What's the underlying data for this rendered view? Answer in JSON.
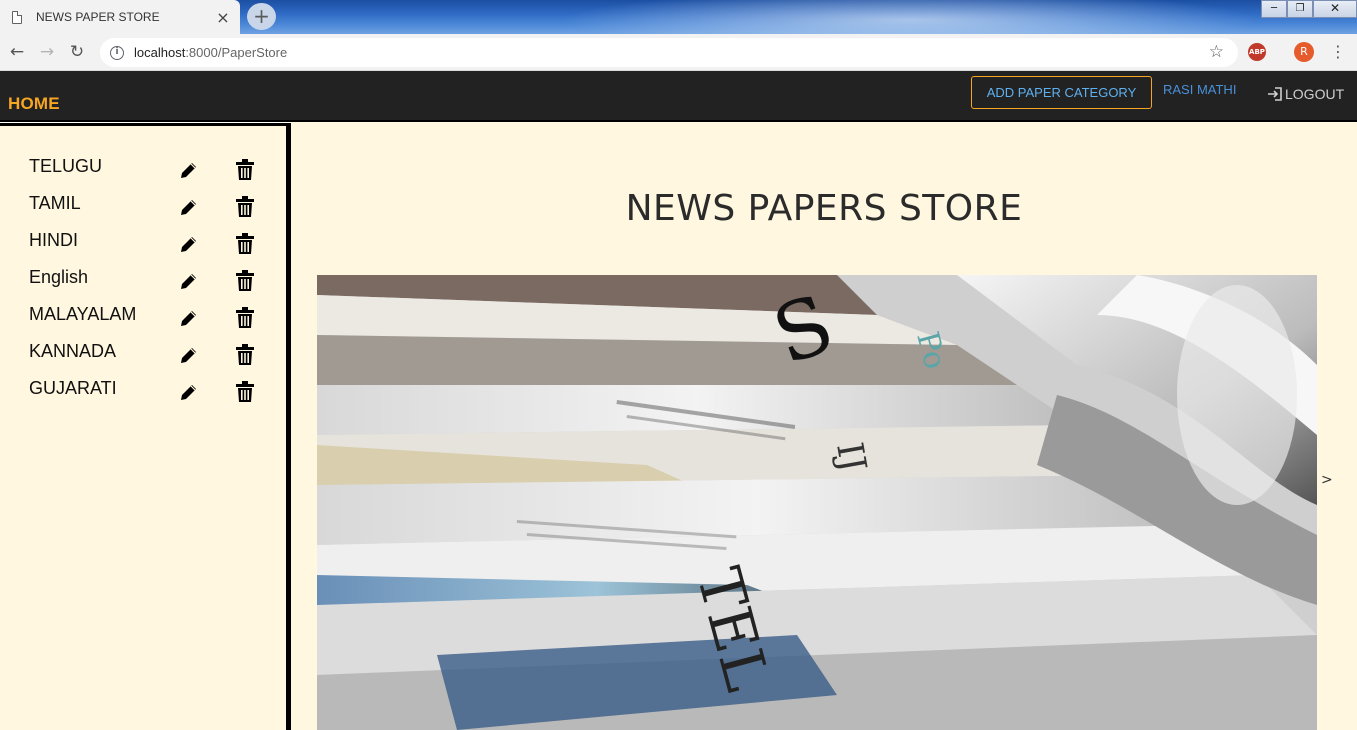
{
  "browser": {
    "tab_title": "NEWS PAPER STORE",
    "tab_close": "×",
    "new_tab": "+",
    "url_host": "localhost",
    "url_path": ":8000/PaperStore",
    "abp": "ABP",
    "profile_initial": "R"
  },
  "navbar": {
    "brand": "HOME",
    "add_category": "ADD PAPER CATEGORY",
    "user": "RASI MATHI",
    "logout": "LOGOUT",
    "accent_color": "#f6a623"
  },
  "sidebar": {
    "items": [
      {
        "label": "TELUGU"
      },
      {
        "label": "TAMIL"
      },
      {
        "label": "HINDI"
      },
      {
        "label": "English"
      },
      {
        "label": "MALAYALAM"
      },
      {
        "label": "KANNADA"
      },
      {
        "label": "GUJARATI"
      }
    ]
  },
  "main": {
    "title": "NEWS PAPERS STORE",
    "carousel_next": ">",
    "image": "stacked-newspapers-photo"
  }
}
